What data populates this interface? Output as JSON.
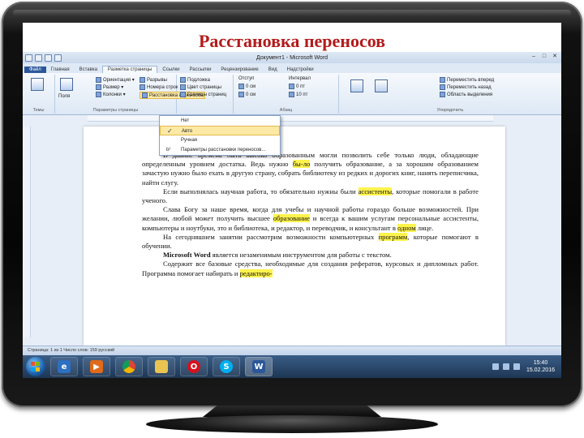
{
  "slide": {
    "title": "Расстановка переносов"
  },
  "window": {
    "title": "Документ1 - Microsoft Word"
  },
  "tabs": [
    "Файл",
    "Главная",
    "Вставка",
    "Разметка страницы",
    "Ссылки",
    "Рассылки",
    "Рецензирование",
    "Вид",
    "Надстройки"
  ],
  "ribbon": {
    "themes_label": "Темы",
    "page_setup_label": "Параметры страницы",
    "fields_label": "Поля",
    "orientation_label": "Ориентация",
    "size_label": "Размер",
    "columns_label": "Колонки",
    "breaks_label": "Разрывы",
    "line_numbers_label": "Номера строк",
    "hyphenation_label": "Расстановка переносов",
    "watermark_label": "Подложка",
    "page_color_label": "Цвет страницы",
    "page_borders_label": "Границы страниц",
    "indent_label": "Отступ",
    "spacing_label": "Интервал",
    "indent_left": "0 см",
    "indent_right": "0 см",
    "spacing_before": "0 пт",
    "spacing_after": "10 пт",
    "paragraph_label": "Абзац",
    "bring_forward_label": "Переместить вперед",
    "send_backward_label": "Переместить назад",
    "selection_pane_label": "Область выделения",
    "arrange_label": "Упорядочить"
  },
  "hyphenation_menu": {
    "items": [
      "Нет",
      "Авто",
      "Ручная",
      "Параметры расстановки переносов..."
    ],
    "selected": "Авто"
  },
  "document": {
    "p1": "В давние времена быть высоко образованным могли позволить себе только люди, обладающие определенным уровнем достатка. Ведь нужно ",
    "p1_hl": "бы-ло",
    "p1_rest": " получить образование, а за хорошим образованием зачастую нужно было ехать в другую страну, собрать библиотеку из редких и дорогих книг, нанять переписчика, найти слугу.",
    "p2": "Если выполнялась научная работа, то обязательно нужны были ",
    "p2_hl": "ассистенты",
    "p2_rest": ", которые помогали в работе ученого.",
    "p3": "Слава Богу за наше время, когда для учебы и научной работы гораздо больше возможностей. При желании, любой может получить высшее ",
    "p3_hl": "образование",
    "p3_rest": " и всегда к вашим услугам персональные ассистенты, компьютеры и ноутбуки, это и библиотека, и редактор, и переводчик, и консультант в ",
    "p3_hl2": "одном",
    "p3_rest2": " лице.",
    "p4": "На сегодняшнем занятии рассмотрим возможности компьютерных ",
    "p4_hl": "программ",
    "p4_rest": ", которые помогают в обучении.",
    "p5_bold": "Microsoft Word",
    "p5_rest": " является незаменимым инструментом для работы с текстом.",
    "p6": "Содержит все базовые средства, необходимые для создания рефератов, курсовых и дипломных работ. Программа помогает набирать и ",
    "p6_hl": "редактиро-"
  },
  "status": {
    "text": "Страница: 1 из 1   Число слов: 159   русский"
  },
  "taskbar": {
    "icons": [
      "explorer-icon",
      "media-player-icon",
      "chrome-icon",
      "folder-icon",
      "opera-icon",
      "skype-icon",
      "word-icon"
    ],
    "time": "15:40",
    "date": "15.02.2016"
  },
  "colors": {
    "title": "#b31b1b",
    "highlight": "#fff34d",
    "word_blue": "#2b579a"
  }
}
